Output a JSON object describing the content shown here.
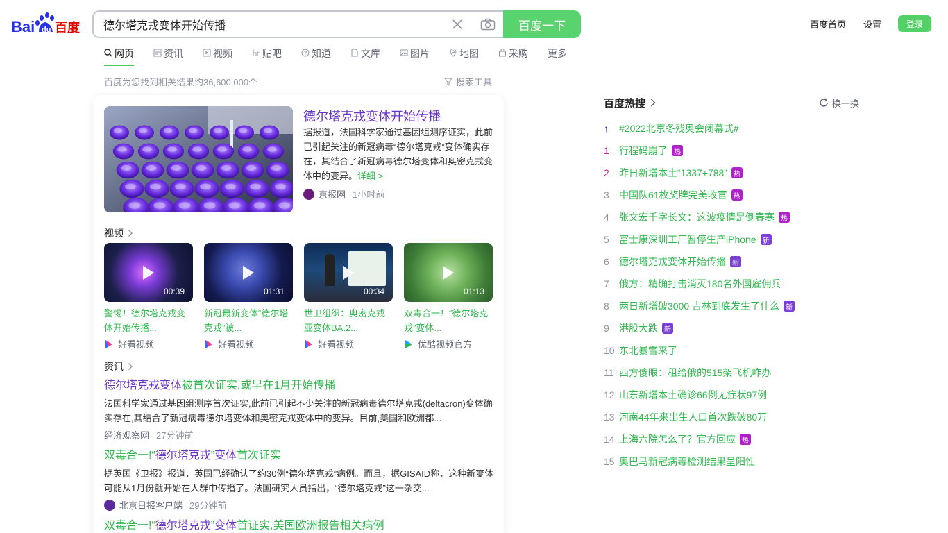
{
  "logo": {
    "text": "Bai百度",
    "alt": "Baidu logo"
  },
  "search": {
    "query": "德尔塔克戎变体开始传播",
    "button": "百度一下"
  },
  "top_links": {
    "home": "百度首页",
    "settings": "设置",
    "login": "登录"
  },
  "tabs": [
    {
      "label": "网页",
      "icon": "search-icon",
      "active": true
    },
    {
      "label": "资讯",
      "icon": "news-icon"
    },
    {
      "label": "视频",
      "icon": "video-icon"
    },
    {
      "label": "贴吧",
      "icon": "tieba-icon"
    },
    {
      "label": "知道",
      "icon": "question-icon"
    },
    {
      "label": "文库",
      "icon": "doc-icon"
    },
    {
      "label": "图片",
      "icon": "image-icon"
    },
    {
      "label": "地图",
      "icon": "map-icon"
    },
    {
      "label": "采购",
      "icon": "purchase-icon"
    },
    {
      "label": "更多"
    }
  ],
  "result_count": "百度为您找到相关结果约36,600,000个",
  "search_tools": "搜索工具",
  "hero": {
    "title": "德尔塔克戎变体开始传播",
    "desc": "据报道，法国科学家通过基因组测序证实，此前已引起关注的新冠病毒“德尔塔克戎”变体确实存在，其结合了新冠病毒德尔塔变体和奥密克戎变体中的变异。",
    "detail": "详细 >",
    "source": "京报网",
    "time": "1小时前"
  },
  "video_section": "视频",
  "videos": [
    {
      "title": "警惕！德尔塔克戎变体开始传播...",
      "duration": "00:39",
      "source": "好看视频"
    },
    {
      "title": "新冠最新变体“德尔塔克戎”被...",
      "duration": "01:31",
      "source": "好看视频"
    },
    {
      "title": "世卫组织：奥密克戎亚变体BA.2...",
      "duration": "00:34",
      "source": "好看视频"
    },
    {
      "title": "双毒合一！“德尔塔克戎”变体...",
      "duration": "01:13",
      "source": "优酷视频官方"
    }
  ],
  "news_section": "资讯",
  "news": [
    {
      "title_em": "德尔塔克戎变体",
      "title_rest": "被首次证实,或早在1月开始传播",
      "desc": "法国科学家通过基因组测序首次证实,此前已引起不少关注的新冠病毒德尔塔克戎(deltacron)变体确实存在,其结合了新冠病毒德尔塔变体和奥密克戎变体中的变异。目前,美国和欧洲都...",
      "source": "经济观察网",
      "time": "27分钟前"
    },
    {
      "title_pre": "双毒合一!“",
      "title_em": "德尔塔克戎",
      "title_mid": "”",
      "title_em2": "变体",
      "title_rest": "首次证实",
      "desc": "据英国《卫报》报道，英国已经确认了约30例“德尔塔克戎”病例。而且，据GISAID称，这种新变体可能从1月份就开始在人群中传播了。法国研究人员指出，“德尔塔克戎”这一杂交...",
      "source": "北京日报客户端",
      "time": "29分钟前"
    },
    {
      "title_pre": "双毒合一!“",
      "title_em": "德尔塔克戎",
      "title_mid": "”",
      "title_em2": "变体",
      "title_rest": "首证实,美国欧洲报告相关病例"
    }
  ],
  "hot": {
    "title": "百度热搜",
    "refresh": "换一换",
    "items": [
      {
        "rank": "↑",
        "text": "#2022北京冬残奥会闭幕式#",
        "badge": ""
      },
      {
        "rank": "1",
        "text": "行程码崩了",
        "badge": "热"
      },
      {
        "rank": "2",
        "text": "昨日新增本土“1337+788”",
        "badge": "热"
      },
      {
        "rank": "3",
        "text": "中国队61枚奖牌完美收官",
        "badge": "热"
      },
      {
        "rank": "4",
        "text": "张文宏千字长文：这波疫情是倒春寒",
        "badge": "热"
      },
      {
        "rank": "5",
        "text": "富士康深圳工厂暂停生产iPhone",
        "badge": "新"
      },
      {
        "rank": "6",
        "text": "德尔塔克戎变体开始传播",
        "badge": "新"
      },
      {
        "rank": "7",
        "text": "俄方：精确打击消灭180名外国雇佣兵",
        "badge": ""
      },
      {
        "rank": "8",
        "text": "两日新增破3000 吉林到底发生了什么",
        "badge": "新"
      },
      {
        "rank": "9",
        "text": "港股大跌",
        "badge": "新"
      },
      {
        "rank": "10",
        "text": "东北暴雪来了",
        "badge": ""
      },
      {
        "rank": "11",
        "text": "西方傻眼：租给俄的515架飞机咋办",
        "badge": ""
      },
      {
        "rank": "12",
        "text": "山东新增本土确诊66例无症状97例",
        "badge": ""
      },
      {
        "rank": "13",
        "text": "河南44年来出生人口首次跌破80万",
        "badge": ""
      },
      {
        "rank": "14",
        "text": "上海六院怎么了？官方回应",
        "badge": "热"
      },
      {
        "rank": "15",
        "text": "奥巴马新冠病毒检测结果呈阳性",
        "badge": ""
      }
    ]
  },
  "colors": {
    "accent": "#4cc759",
    "link": "#2fb84e",
    "emphasis": "#6a34c8",
    "hot_badge": "#b022c9"
  }
}
